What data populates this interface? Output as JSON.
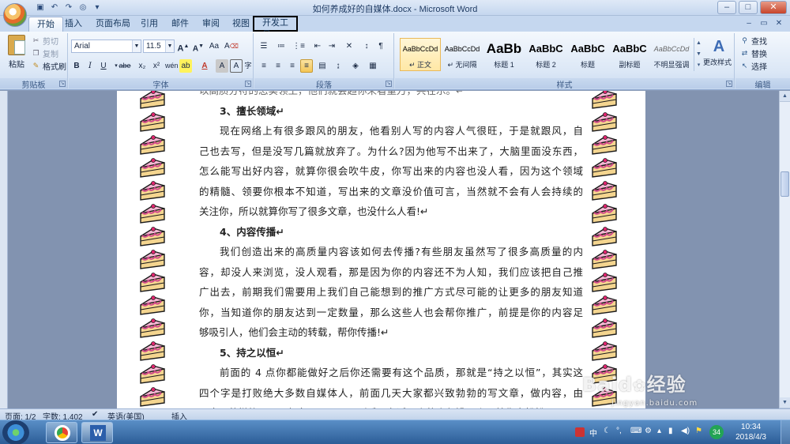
{
  "window": {
    "title": "如何养成好的自媒体.docx - Microsoft Word",
    "controls": [
      "–",
      "□",
      "✕"
    ]
  },
  "quick_access": [
    "save-icon",
    "undo-icon",
    "redo-icon",
    "print-preview-icon",
    "customize-icon"
  ],
  "tabs": [
    {
      "label": "开始",
      "active": true
    },
    {
      "label": "插入"
    },
    {
      "label": "页面布局"
    },
    {
      "label": "引用"
    },
    {
      "label": "邮件"
    },
    {
      "label": "审阅"
    },
    {
      "label": "视图"
    },
    {
      "label": "开发工具",
      "highlighted": true
    }
  ],
  "ribbon": {
    "clipboard": {
      "group_label": "剪贴板",
      "paste": "粘贴",
      "cut": "剪切",
      "copy": "复制",
      "format_painter": "格式刷"
    },
    "font": {
      "group_label": "字体",
      "font_name": "Arial",
      "font_size": "11.5",
      "grow": "A",
      "shrink": "A",
      "bold": "B",
      "italic": "I",
      "underline": "U",
      "strikethrough": "abe",
      "subscript": "x₂",
      "superscript": "x²",
      "change_case": "Aa",
      "highlight": "ab",
      "font_color": "A",
      "char_shade": "A",
      "char_border": "A",
      "clear_format": "A",
      "phonetic": "wén",
      "enclose": "字"
    },
    "paragraph": {
      "group_label": "段落"
    },
    "styles": {
      "group_label": "样式",
      "items": [
        {
          "preview": "AaBbCcDd",
          "name": "↵ 正文",
          "selected": true
        },
        {
          "preview": "AaBbCcDd",
          "name": "↵ 无间隔"
        },
        {
          "preview": "AaBb",
          "name": "标题 1"
        },
        {
          "preview": "AaBbC",
          "name": "标题 2"
        },
        {
          "preview": "AaBbC",
          "name": "标题"
        },
        {
          "preview": "AaBbC",
          "name": "副标题"
        },
        {
          "preview": "AaBbCcDd",
          "name": "不明显强调"
        }
      ],
      "change_styles": "更改样式"
    },
    "editing": {
      "group_label": "编辑",
      "find": "查找",
      "replace": "替换",
      "select": "选择"
    }
  },
  "document": {
    "lines": [
      {
        "text": "以高质分符的怎实领土，他们就会趋你来看重万，共在乐。↵",
        "type": "cut"
      },
      {
        "text": "3、擅长领域↵",
        "type": "heading"
      },
      {
        "text": "现在网络上有很多跟风的朋友，他看别人写的内容人气很旺，于是就跟风，自",
        "type": "first"
      },
      {
        "text": "己也去写，但是没写几篇就放弃了。为什么?因为他写不出来了，大脑里面没东西，",
        "type": "body"
      },
      {
        "text": "怎么能写出好内容，就算你很会吹牛皮，你写出来的内容也没人看，因为这个领域",
        "type": "body"
      },
      {
        "text": "的精髓、领要你根本不知道，写出来的文章没价值可言，当然就不会有人会持续的",
        "type": "body"
      },
      {
        "text": "关注你，所以就算你写了很多文章，也没什么人看!↵",
        "type": "body"
      },
      {
        "text": "4、内容传播↵",
        "type": "heading"
      },
      {
        "text": "我们创造出来的高质量内容该如何去传播?有些朋友虽然写了很多高质量的内",
        "type": "first"
      },
      {
        "text": "容，却没人来浏览，没人观看，那是因为你的内容还不为人知，我们应该把自己推",
        "type": "body"
      },
      {
        "text": "广出去，前期我们需要用上我们自己能想到的推广方式尽可能的让更多的朋友知道",
        "type": "body"
      },
      {
        "text": "你，当知道你的朋友达到一定数量，那么这些人也会帮你推广，前提是你的内容足",
        "type": "body"
      },
      {
        "text": "够吸引人，他们会主动的转载，帮你传播!↵",
        "type": "body"
      },
      {
        "text": "5、持之以恒↵",
        "type": "heading"
      },
      {
        "text": "前面的 4 点你都能做好之后你还需要有这个品质，那就是“持之以恒”，其实这",
        "type": "first"
      },
      {
        "text": "四个字是打败绝大多数自媒体人，前面几天大家都兴致勃勃的写文章，做内容，由",
        "type": "body"
      },
      {
        "text": "于自己的懒惰，三天打鱼两天晒网，到后面有适不来的人却没几个，就像点粉粉",
        "type": "body"
      }
    ]
  },
  "statusbar": {
    "page": "页面: 1/2",
    "words": "字数: 1,402",
    "language": "英语(美国)",
    "mode": "插入"
  },
  "watermark": {
    "brand": "Baid",
    "suffix": "经验",
    "url": "jingyan.baidu.com"
  },
  "taskbar": {
    "time": "10:34",
    "date": "2018/4/3",
    "ime": "中",
    "badge": "34"
  },
  "colors": {
    "accent": "#2c5d97",
    "ribbon": "#dbe7f6",
    "highlight_box": "#000000"
  }
}
